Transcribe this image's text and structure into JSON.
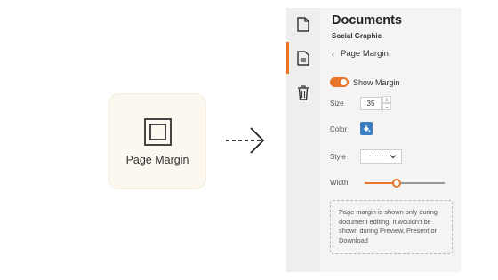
{
  "preview_card": {
    "label": "Page Margin",
    "icon": "page-margin-frame-icon"
  },
  "transition": {
    "icon": "dashed-arrow-right-icon"
  },
  "rail": {
    "items": [
      {
        "name": "page",
        "icon": "page-icon",
        "active": false
      },
      {
        "name": "document-settings",
        "icon": "document-lines-icon",
        "active": true
      },
      {
        "name": "delete",
        "icon": "trash-icon",
        "active": false
      }
    ]
  },
  "panel": {
    "title": "Documents",
    "subtitle": "Social Graphic",
    "back_label": "Page Margin",
    "show_margin": {
      "label": "Show Margin",
      "on": true
    },
    "size": {
      "label": "Size",
      "value": "35",
      "increment": "+",
      "decrement": "-"
    },
    "color": {
      "label": "Color",
      "value": "#3d7fc4"
    },
    "style": {
      "label": "Style",
      "value": "dotted"
    },
    "width": {
      "label": "Width",
      "level": 0.4
    },
    "note": "Page margin is shown only during document editing. It wouldn't be shown during Preview, Present or Download"
  },
  "colors": {
    "accent": "#e8762a",
    "card_bg": "#fdf8ef",
    "panel_bg": "#f4f4f5"
  }
}
